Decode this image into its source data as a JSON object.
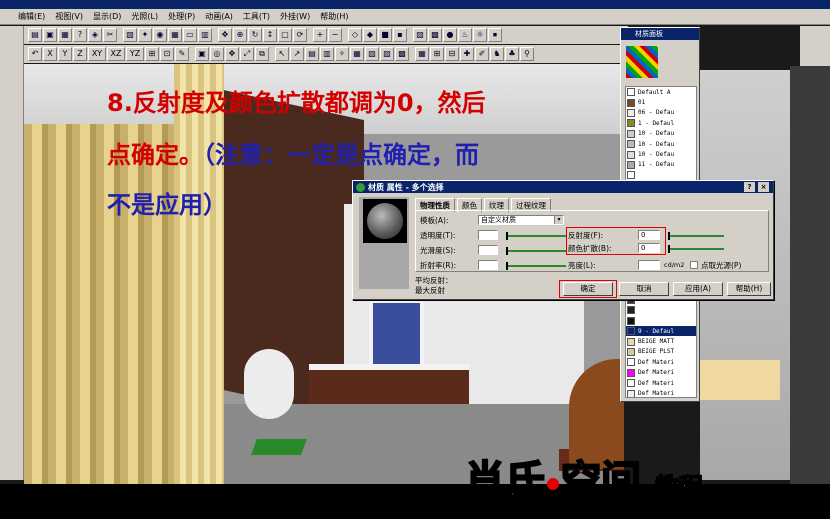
{
  "menu": {
    "items": [
      "编辑(E)",
      "视图(V)",
      "显示(D)",
      "光照(L)",
      "处理(P)",
      "动画(A)",
      "工具(T)",
      "外挂(W)",
      "帮助(H)"
    ]
  },
  "toolbar": {
    "axes": [
      "X",
      "Y",
      "Z",
      "XY",
      "XZ",
      "YZ"
    ]
  },
  "instruction": {
    "line1": "8.反射度及颜色扩散都调为0，然后",
    "line2_red": "点确定。",
    "line2_blue": "（注意：一定是点确定，而",
    "line3": "不是应用）"
  },
  "material_panel": {
    "title": "材质面板",
    "items": [
      {
        "label": "Default A",
        "color": "#ffffff"
      },
      {
        "label": "01",
        "color": "#7a4a2a"
      },
      {
        "label": "06 - Defau",
        "color": "#eeeeee"
      },
      {
        "label": "1 - Defaul",
        "color": "#8a8a20"
      },
      {
        "label": "10 - Defau",
        "color": "#cccccc"
      },
      {
        "label": "10 - Defau",
        "color": "#bbbbbb"
      },
      {
        "label": "10 - Defau",
        "color": "#dddddd"
      },
      {
        "label": "11 - Defau",
        "color": "#aaaaaa"
      },
      {
        "label": "",
        "color": "#ffffff"
      },
      {
        "label": "",
        "color": "#eeeeee"
      },
      {
        "label": "",
        "color": "#dddddd"
      },
      {
        "label": "",
        "color": "#cccccc"
      },
      {
        "label": "",
        "color": "#bbbbbb"
      },
      {
        "label": "",
        "color": "#aaaaaa"
      },
      {
        "label": "",
        "color": "#999999"
      },
      {
        "label": "",
        "color": "#888888"
      },
      {
        "label": "",
        "color": "#777777"
      },
      {
        "label": "",
        "color": "#666666"
      },
      {
        "label": "",
        "color": "#555555"
      },
      {
        "label": "",
        "color": "#444444"
      },
      {
        "label": "",
        "color": "#333333"
      },
      {
        "label": "",
        "color": "#222222"
      },
      {
        "label": "",
        "color": "#111111"
      },
      {
        "label": "9 - Defaul",
        "color": "#0a246a",
        "selected": true
      },
      {
        "label": "BEIGE MATT",
        "color": "#e8d8b0"
      },
      {
        "label": "BEIGE PLST",
        "color": "#d8c8a0"
      },
      {
        "label": "Def Materi",
        "color": "#ffffff"
      },
      {
        "label": "Def Materi",
        "color": "#ff00ff"
      },
      {
        "label": "Def Materi",
        "color": "#ffffff"
      },
      {
        "label": "Def Materi",
        "color": "#eeeeee"
      },
      {
        "label": "Def Materi",
        "color": "#ffff00"
      }
    ]
  },
  "dialog": {
    "title": "材质 属性 - 多个选择",
    "help_label": "?",
    "close_label": "×",
    "tabs": [
      "物理性质",
      "颜色",
      "纹理",
      "过程纹理"
    ],
    "template_label": "模板(A):",
    "template_value": "自定义材质",
    "transparency_label": "透明度(T):",
    "smoothness_label": "光滑度(S):",
    "refraction_label": "折射率(R):",
    "reflectance_label": "反射度(F):",
    "reflectance_value": "0",
    "color_bleed_label": "颜色扩散(B):",
    "color_bleed_value": "0",
    "luminance_label": "亮度(L):",
    "luminance_unit": "cd/m2",
    "light_source_label": "点取光源(P)",
    "avg_reflect_label": "平均反射：",
    "max_reflect_label": "最大反射",
    "ok_label": "确定",
    "cancel_label": "取消",
    "apply_label": "应用(A)",
    "help_button_label": "帮助(H)"
  },
  "brand": {
    "name_part1": "肖氏",
    "name_part2": "空间",
    "suffix": "教程"
  },
  "colors": {
    "instruction_red": "#d40000",
    "instruction_blue": "#2020b0",
    "highlight": "#e00000",
    "titlebar": "#0a246a"
  }
}
